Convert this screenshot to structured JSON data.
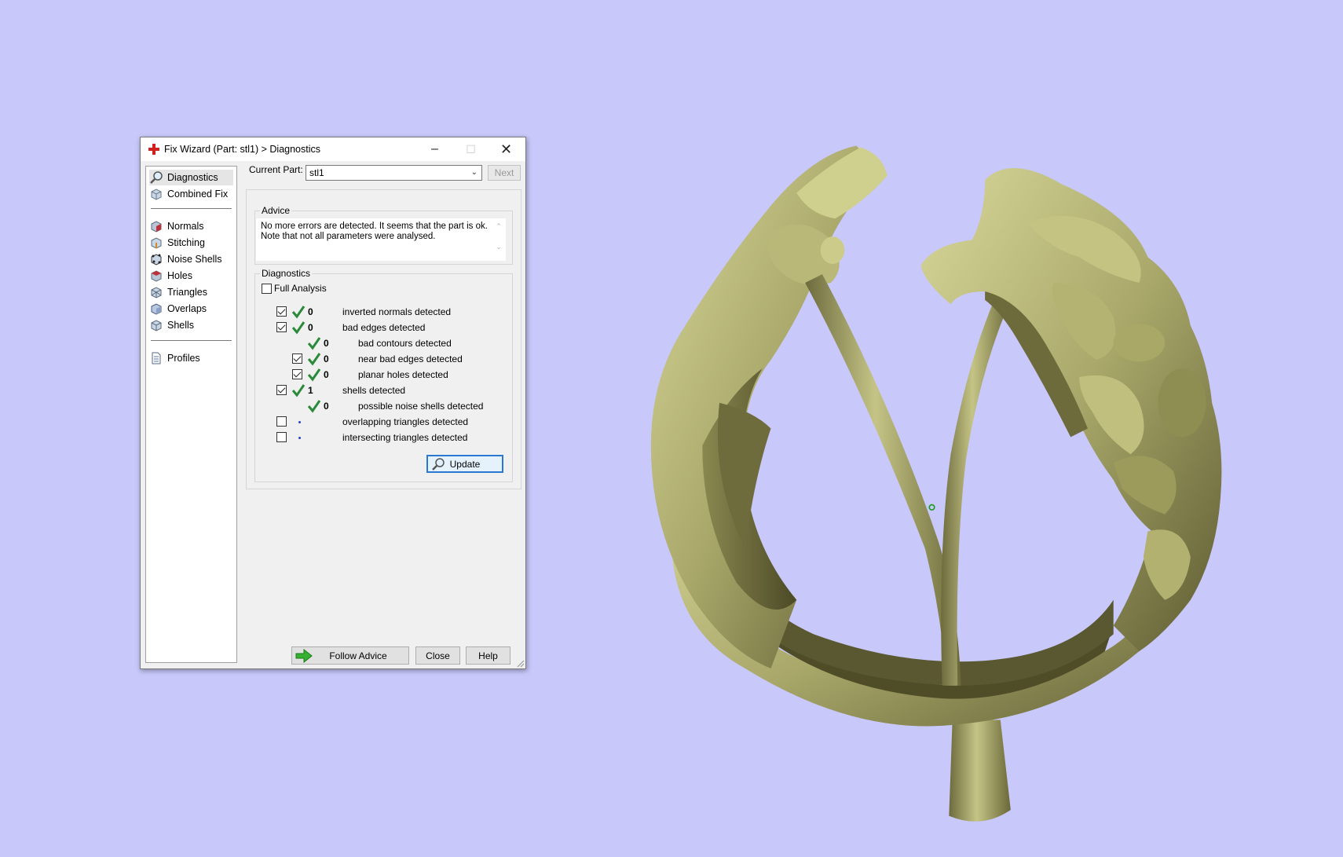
{
  "window": {
    "title": "Fix Wizard (Part: stl1) > Diagnostics",
    "minimize": "–",
    "maximize": "☐",
    "close": "✕"
  },
  "sidebar": {
    "items": [
      {
        "label": "Diagnostics",
        "icon": "magnifier-icon",
        "selected": true
      },
      {
        "label": "Combined Fix",
        "icon": "cube-icon"
      },
      {
        "label": "Normals",
        "icon": "normals-cube-icon"
      },
      {
        "label": "Stitching",
        "icon": "stitching-cube-icon"
      },
      {
        "label": "Noise Shells",
        "icon": "noise-shells-icon"
      },
      {
        "label": "Holes",
        "icon": "holes-cube-icon"
      },
      {
        "label": "Triangles",
        "icon": "triangles-cube-icon"
      },
      {
        "label": "Overlaps",
        "icon": "overlaps-cube-icon"
      },
      {
        "label": "Shells",
        "icon": "shells-cube-icon"
      },
      {
        "label": "Profiles",
        "icon": "document-icon"
      }
    ]
  },
  "header": {
    "current_part_label": "Current Part:",
    "current_part_value": "stl1",
    "next_label": "Next"
  },
  "advice": {
    "title": "Advice",
    "line1": "No more errors are detected. It seems that the part is ok.",
    "line2": "Note that not all parameters were analysed."
  },
  "diagnostics": {
    "title": "Diagnostics",
    "full_analysis_label": "Full Analysis",
    "full_analysis_checked": false,
    "rows": [
      {
        "checked": true,
        "has_check": true,
        "status": "ok",
        "count": "0",
        "label": "inverted normals detected",
        "indent": 0
      },
      {
        "checked": true,
        "has_check": true,
        "status": "ok",
        "count": "0",
        "label": "bad edges detected",
        "indent": 0
      },
      {
        "checked": false,
        "has_check": false,
        "status": "ok",
        "count": "0",
        "label": "bad contours detected",
        "indent": 1
      },
      {
        "checked": true,
        "has_check": true,
        "status": "ok",
        "count": "0",
        "label": "near bad edges detected",
        "indent": 1
      },
      {
        "checked": true,
        "has_check": true,
        "status": "ok",
        "count": "0",
        "label": "planar holes detected",
        "indent": 1
      },
      {
        "checked": true,
        "has_check": true,
        "status": "ok",
        "count": "1",
        "label": "shells detected",
        "indent": 0
      },
      {
        "checked": false,
        "has_check": false,
        "status": "ok",
        "count": "0",
        "label": "possible noise shells detected",
        "indent": 1
      },
      {
        "checked": false,
        "has_check": true,
        "status": "pending",
        "count": "",
        "label": "overlapping triangles detected",
        "indent": 0
      },
      {
        "checked": false,
        "has_check": true,
        "status": "pending",
        "count": "",
        "label": "intersecting triangles detected",
        "indent": 0
      }
    ],
    "update_label": "Update"
  },
  "footer": {
    "follow_advice_label": "Follow Advice",
    "close_label": "Close",
    "help_label": "Help"
  },
  "colors": {
    "background": "#c8c8fa",
    "model": "#a8a868",
    "ok_tick": "#2a8a3a",
    "pending_dot": "#2244cc"
  }
}
